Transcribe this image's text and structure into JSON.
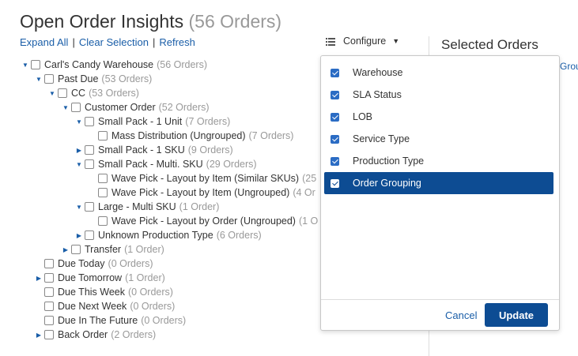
{
  "page": {
    "title": "Open Order Insights",
    "title_count": "(56 Orders)"
  },
  "links": {
    "expand_all": "Expand All",
    "clear_selection": "Clear Selection",
    "refresh": "Refresh",
    "separator": "|"
  },
  "tree": {
    "nodes": [
      {
        "label": "Carl's Candy Warehouse",
        "count": "(56 Orders)",
        "arrow": "down"
      },
      {
        "label": "Past Due",
        "count": "(53 Orders)",
        "arrow": "down"
      },
      {
        "label": "CC",
        "count": "(53 Orders)",
        "arrow": "down"
      },
      {
        "label": "Customer Order",
        "count": "(52 Orders)",
        "arrow": "down"
      },
      {
        "label": "Small Pack - 1 Unit",
        "count": "(7 Orders)",
        "arrow": "down"
      },
      {
        "label": "Mass Distribution (Ungrouped)",
        "count": "(7 Orders)",
        "arrow": "none"
      },
      {
        "label": "Small Pack - 1 SKU",
        "count": "(9 Orders)",
        "arrow": "right"
      },
      {
        "label": "Small Pack - Multi. SKU",
        "count": "(29 Orders)",
        "arrow": "down"
      },
      {
        "label": "Wave Pick - Layout by Item (Similar SKUs)",
        "count": "(25",
        "arrow": "none"
      },
      {
        "label": "Wave Pick - Layout by Item (Ungrouped)",
        "count": "(4 Or",
        "arrow": "none"
      },
      {
        "label": "Large - Multi SKU",
        "count": "(1 Order)",
        "arrow": "down"
      },
      {
        "label": "Wave Pick - Layout by Order (Ungrouped)",
        "count": "(1 O",
        "arrow": "none"
      },
      {
        "label": "Unknown Production Type",
        "count": "(6 Orders)",
        "arrow": "right"
      },
      {
        "label": "Transfer",
        "count": "(1 Order)",
        "arrow": "right"
      },
      {
        "label": "Due Today",
        "count": "(0 Orders)",
        "arrow": "none"
      },
      {
        "label": "Due Tomorrow",
        "count": "(1 Order)",
        "arrow": "right"
      },
      {
        "label": "Due This Week",
        "count": "(0 Orders)",
        "arrow": "none"
      },
      {
        "label": "Due Next Week",
        "count": "(0 Orders)",
        "arrow": "none"
      },
      {
        "label": "Due In The Future",
        "count": "(0 Orders)",
        "arrow": "none"
      },
      {
        "label": "Back Order",
        "count": "(2 Orders)",
        "arrow": "right"
      }
    ]
  },
  "configure": {
    "label": "Configure",
    "icon": "list-icon",
    "caret": "▼",
    "options": [
      {
        "label": "Warehouse",
        "checked": true,
        "active": false
      },
      {
        "label": "SLA Status",
        "checked": true,
        "active": false
      },
      {
        "label": "LOB",
        "checked": true,
        "active": false
      },
      {
        "label": "Service Type",
        "checked": true,
        "active": false
      },
      {
        "label": "Production Type",
        "checked": true,
        "active": false
      },
      {
        "label": "Order Grouping",
        "checked": true,
        "active": true
      }
    ],
    "cancel_label": "Cancel",
    "update_label": "Update"
  },
  "selected": {
    "title": "Selected Orders",
    "truncated_link": "Grou"
  },
  "colors": {
    "link": "#1a5ea8",
    "accent": "#0d4c93",
    "checkbox": "#2b6cc4",
    "muted": "#999999"
  }
}
